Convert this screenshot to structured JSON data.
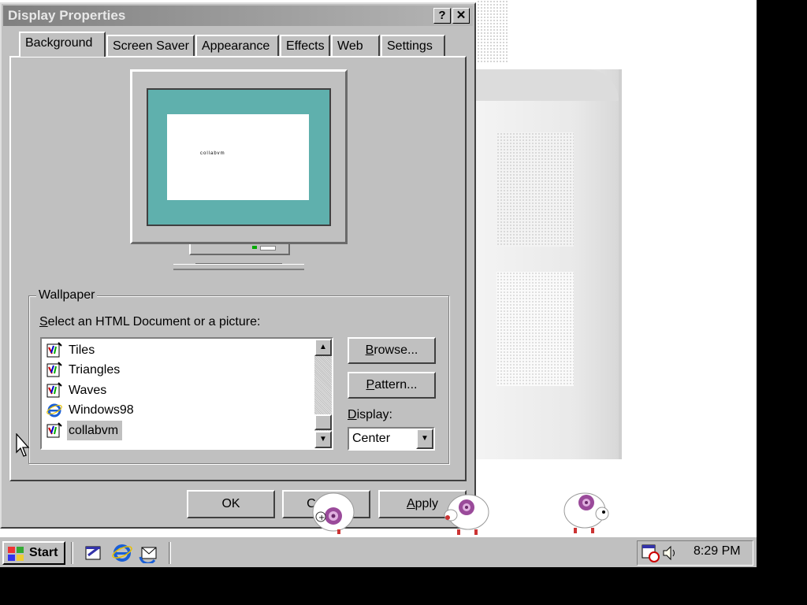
{
  "window": {
    "title": "Display Properties",
    "help_label": "?",
    "close_label": "✕"
  },
  "tabs": [
    {
      "label": "Background",
      "active": true
    },
    {
      "label": "Screen Saver"
    },
    {
      "label": "Appearance"
    },
    {
      "label": "Effects"
    },
    {
      "label": "Web"
    },
    {
      "label": "Settings"
    }
  ],
  "preview": {
    "wallpaper_text": "collabvm"
  },
  "wallpaper": {
    "group_label": "Wallpaper",
    "select_prefix": "S",
    "select_rest": "elect an HTML Document or a picture:",
    "items": [
      {
        "label": "Tiles",
        "icon": "paint-bitmap-icon"
      },
      {
        "label": "Triangles",
        "icon": "paint-bitmap-icon"
      },
      {
        "label": "Waves",
        "icon": "paint-bitmap-icon"
      },
      {
        "label": "Windows98",
        "icon": "internet-explorer-icon"
      },
      {
        "label": "collabvm",
        "icon": "paint-bitmap-icon",
        "selected": true
      }
    ],
    "browse_u": "B",
    "browse_rest": "rowse...",
    "pattern_u": "P",
    "pattern_rest": "attern...",
    "display_u": "D",
    "display_rest": "isplay:",
    "display_value": "Center"
  },
  "buttons": {
    "ok": "OK",
    "cancel": "Cancel",
    "apply_u": "A",
    "apply_rest": "pply"
  },
  "taskbar": {
    "start_label": "Start",
    "quick_launch": [
      "show-desktop-icon",
      "internet-explorer-icon",
      "outlook-express-icon"
    ],
    "tray_icons": [
      "scheduler-icon",
      "volume-icon"
    ],
    "clock": "8:29 PM"
  },
  "colors": {
    "preview_screen": "#5fb0ad",
    "title_gradient_start": "#808080",
    "face": "#c0c0c0"
  }
}
